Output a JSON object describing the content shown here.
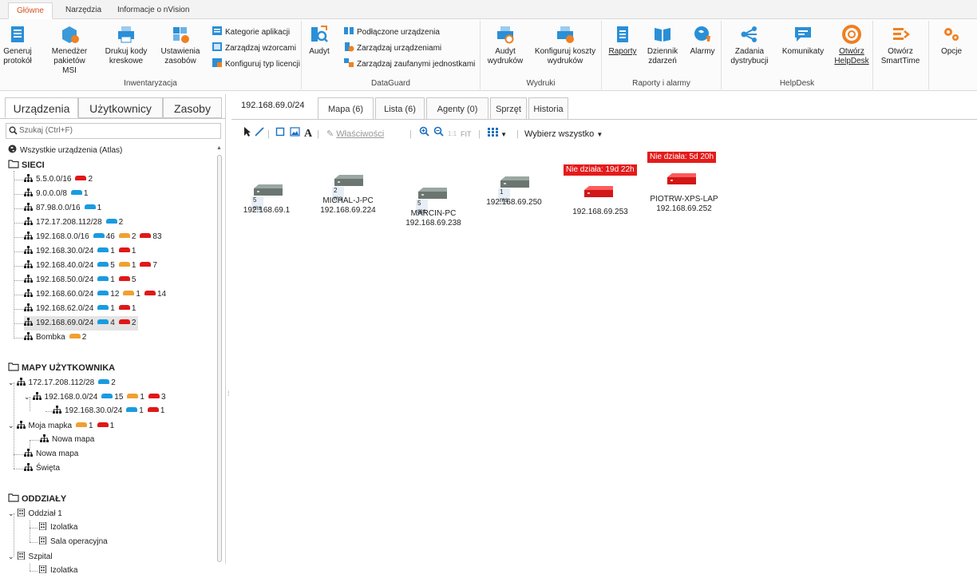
{
  "ribbon": {
    "tabs": [
      "Główne",
      "Narzędzia",
      "Informacje o nVision"
    ],
    "active_tab": "Główne",
    "groups": {
      "inwentaryzacja": {
        "label": "Inwentaryzacja",
        "buttons": [
          "Generuj protokół",
          "Menedżer pakietów MSI",
          "Drukuj kody kreskowe",
          "Ustawienia zasobów"
        ],
        "small": [
          "Kategorie aplikacji",
          "Zarządzaj wzorcami",
          "Konfiguruj typ licencji"
        ]
      },
      "dataguard": {
        "label": "DataGuard",
        "buttons": [
          "Audyt"
        ],
        "small": [
          "Podłączone urządzenia",
          "Zarządzaj urządzeniami",
          "Zarządzaj zaufanymi jednostkami"
        ]
      },
      "wydruki": {
        "label": "Wydruki",
        "buttons": [
          "Audyt wydruków",
          "Konfiguruj koszty wydruków"
        ]
      },
      "raporty": {
        "label": "Raporty i alarmy",
        "buttons": [
          "Raporty",
          "Dziennik zdarzeń",
          "Alarmy"
        ]
      },
      "helpdesk": {
        "label": "HelpDesk",
        "buttons": [
          "Zadania dystrybucji",
          "Komunikaty",
          "Otwórz HelpDesk"
        ]
      },
      "other": {
        "buttons": [
          "Otwórz SmartTime",
          "Opcje"
        ]
      }
    }
  },
  "left": {
    "tabs": [
      "Urządzenia",
      "Użytkownicy",
      "Zasoby"
    ],
    "search_placeholder": "Szukaj (Ctrl+F)",
    "all_devices": "Wszystkie urządzenia (Atlas)",
    "sieci_header": "SIECI",
    "networks": [
      {
        "name": "5.5.0.0/16",
        "badges": [
          {
            "c": "r",
            "n": "2"
          }
        ]
      },
      {
        "name": "9.0.0.0/8",
        "badges": [
          {
            "c": "b",
            "n": "1"
          }
        ]
      },
      {
        "name": "87.98.0.0/16",
        "badges": [
          {
            "c": "b",
            "n": "1"
          }
        ]
      },
      {
        "name": "172.17.208.112/28",
        "badges": [
          {
            "c": "b",
            "n": "2"
          }
        ]
      },
      {
        "name": "192.168.0.0/16",
        "badges": [
          {
            "c": "b",
            "n": "46"
          },
          {
            "c": "o",
            "n": "2"
          },
          {
            "c": "r",
            "n": "83"
          }
        ]
      },
      {
        "name": "192.168.30.0/24",
        "badges": [
          {
            "c": "b",
            "n": "1"
          },
          {
            "c": "r",
            "n": "1"
          }
        ]
      },
      {
        "name": "192.168.40.0/24",
        "badges": [
          {
            "c": "b",
            "n": "5"
          },
          {
            "c": "o",
            "n": "1"
          },
          {
            "c": "r",
            "n": "7"
          }
        ]
      },
      {
        "name": "192.168.50.0/24",
        "badges": [
          {
            "c": "b",
            "n": "1"
          },
          {
            "c": "r",
            "n": "5"
          }
        ]
      },
      {
        "name": "192.168.60.0/24",
        "badges": [
          {
            "c": "b",
            "n": "12"
          },
          {
            "c": "o",
            "n": "1"
          },
          {
            "c": "r",
            "n": "14"
          }
        ]
      },
      {
        "name": "192.168.62.0/24",
        "badges": [
          {
            "c": "b",
            "n": "1"
          },
          {
            "c": "r",
            "n": "1"
          }
        ]
      },
      {
        "name": "192.168.69.0/24",
        "badges": [
          {
            "c": "b",
            "n": "4"
          },
          {
            "c": "r",
            "n": "2"
          }
        ],
        "selected": true
      },
      {
        "name": "Bombka",
        "badges": [
          {
            "c": "o",
            "n": "2"
          }
        ]
      }
    ],
    "mapy_header": "MAPY UŻYTKOWNIKA",
    "maps": [
      {
        "name": "172.17.208.112/28",
        "badges": [
          {
            "c": "b",
            "n": "2"
          }
        ]
      },
      {
        "name": "192.168.0.0/24",
        "badges": [
          {
            "c": "b",
            "n": "15"
          },
          {
            "c": "o",
            "n": "1"
          },
          {
            "c": "r",
            "n": "3"
          }
        ]
      },
      {
        "name": "192.168.30.0/24",
        "badges": [
          {
            "c": "b",
            "n": "1"
          },
          {
            "c": "r",
            "n": "1"
          }
        ]
      },
      {
        "name": "Moja mapka",
        "badges": [
          {
            "c": "o",
            "n": "1"
          },
          {
            "c": "r",
            "n": "1"
          }
        ]
      },
      {
        "name": "Nowa mapa",
        "badges": []
      },
      {
        "name": "Nowa mapa",
        "badges": []
      },
      {
        "name": "Święta",
        "badges": []
      }
    ],
    "oddzialy_header": "ODDZIAŁY",
    "branches": [
      "Oddział 1",
      "Izolatka",
      "Sala operacyjna",
      "Szpital",
      "Izolatka"
    ]
  },
  "main": {
    "network_title": "192.168.69.0/24",
    "tabs": [
      "Mapa (6)",
      "Lista (6)",
      "Agenty (0)",
      "Sprzęt",
      "Historia"
    ],
    "active_tab": "Mapa (6)",
    "toolbar": {
      "properties": "Właściwości",
      "fit": "FIT",
      "select_all": "Wybierz wszystko"
    },
    "devices": [
      {
        "name": "",
        "ip": "192.168.69.1",
        "ms": "5 ms",
        "down": ""
      },
      {
        "name": "MICHAL-J-PC",
        "ip": "192.168.69.224",
        "ms": "2 ms",
        "down": ""
      },
      {
        "name": "MARCIN-PC",
        "ip": "192.168.69.238",
        "ms": "5 ms",
        "down": ""
      },
      {
        "name": "",
        "ip": "192.168.69.250",
        "ms": "1 ms",
        "down": ""
      },
      {
        "name": "",
        "ip": "192.168.69.253",
        "ms": "",
        "down": "Nie działa: 19d 22h"
      },
      {
        "name": "PIOTRW-XPS-LAP",
        "ip": "192.168.69.252",
        "ms": "",
        "down": "Nie działa: 5d 20h"
      }
    ]
  },
  "colors": {
    "accent": "#d4521f",
    "blue": "#1a9be0",
    "orange": "#f0a030",
    "red": "#e01818"
  }
}
